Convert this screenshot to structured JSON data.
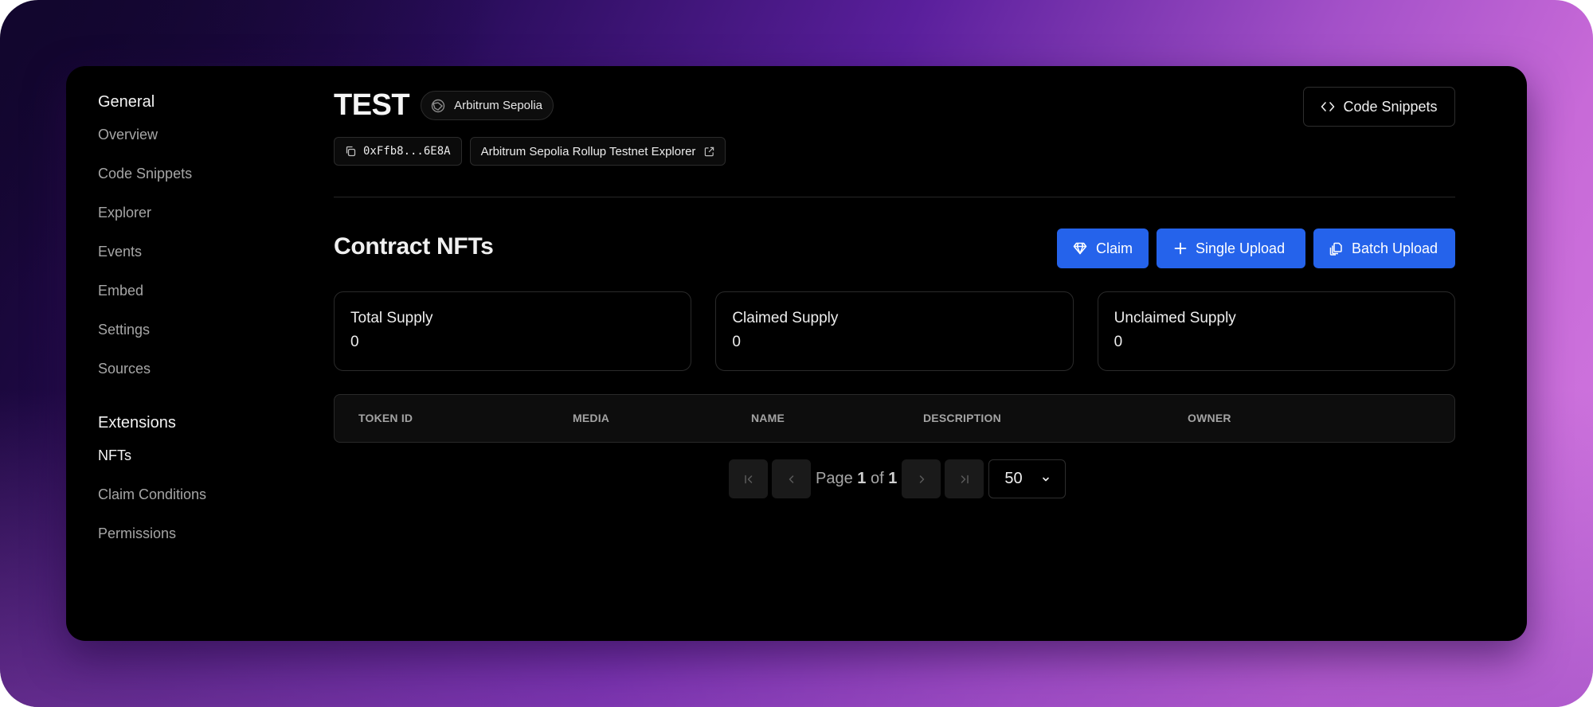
{
  "sidebar": {
    "groups": [
      {
        "heading": "General",
        "items": [
          {
            "label": "Overview",
            "active": false
          },
          {
            "label": "Code Snippets",
            "active": false
          },
          {
            "label": "Explorer",
            "active": false
          },
          {
            "label": "Events",
            "active": false
          },
          {
            "label": "Embed",
            "active": false
          },
          {
            "label": "Settings",
            "active": false
          },
          {
            "label": "Sources",
            "active": false
          }
        ]
      },
      {
        "heading": "Extensions",
        "items": [
          {
            "label": "NFTs",
            "active": true
          },
          {
            "label": "Claim Conditions",
            "active": false
          },
          {
            "label": "Permissions",
            "active": false
          }
        ]
      }
    ]
  },
  "header": {
    "title": "TEST",
    "chain_badge": {
      "label": "Arbitrum Sepolia",
      "icon": "globe-network-icon"
    },
    "address_chip": {
      "label": "0xFfb8...6E8A",
      "icon": "copy-icon"
    },
    "explorer_chip": {
      "label": "Arbitrum Sepolia Rollup Testnet Explorer",
      "icon": "external-link-icon"
    },
    "code_snippets_button": {
      "label": "Code Snippets",
      "icon": "code-brackets-icon"
    }
  },
  "section": {
    "title": "Contract NFTs",
    "actions": [
      {
        "label": "Claim",
        "icon": "diamond-icon"
      },
      {
        "label": "Single Upload",
        "icon": "plus-icon"
      },
      {
        "label": "Batch Upload",
        "icon": "files-icon"
      }
    ]
  },
  "stats": [
    {
      "label": "Total Supply",
      "value": "0"
    },
    {
      "label": "Claimed Supply",
      "value": "0"
    },
    {
      "label": "Unclaimed Supply",
      "value": "0"
    }
  ],
  "table": {
    "columns": [
      "TOKEN ID",
      "MEDIA",
      "NAME",
      "DESCRIPTION",
      "OWNER"
    ],
    "rows": []
  },
  "pagination": {
    "page_prefix": "Page",
    "current_page": "1",
    "of_text": "of",
    "total_pages": "1",
    "page_size": "50"
  },
  "colors": {
    "accent": "#2563eb",
    "window_bg": "#000000"
  }
}
